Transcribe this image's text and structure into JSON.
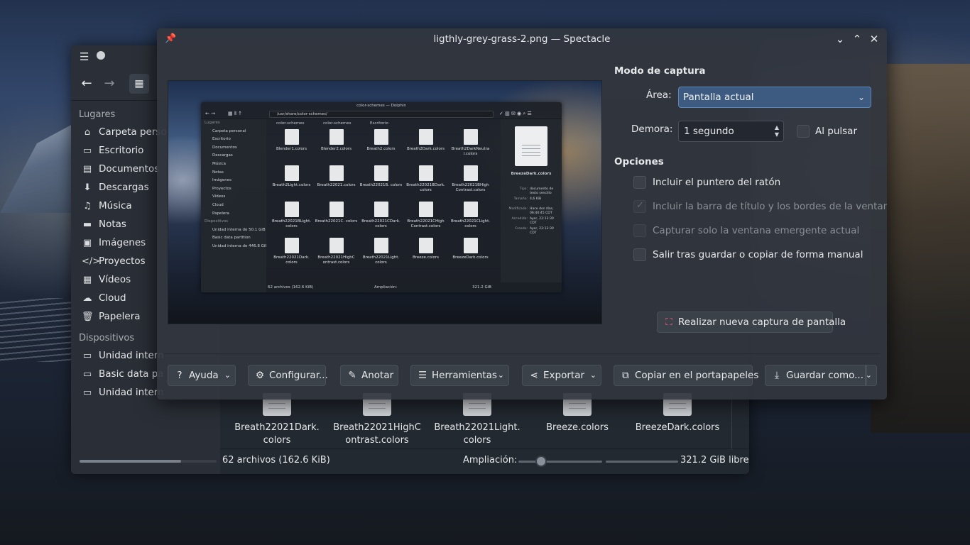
{
  "dolphin": {
    "sidebar": {
      "places_heading": "Lugares",
      "places": [
        {
          "icon": "home-icon",
          "glyph": "⌂",
          "label": "Carpeta perso"
        },
        {
          "icon": "desktop-icon",
          "glyph": "▭",
          "label": "Escritorio"
        },
        {
          "icon": "documents-icon",
          "glyph": "▤",
          "label": "Documentos"
        },
        {
          "icon": "downloads-icon",
          "glyph": "⬇",
          "label": "Descargas"
        },
        {
          "icon": "music-icon",
          "glyph": "♫",
          "label": "Música"
        },
        {
          "icon": "notes-folder-icon",
          "glyph": "▬",
          "label": "Notas"
        },
        {
          "icon": "images-icon",
          "glyph": "▣",
          "label": "Imágenes"
        },
        {
          "icon": "code-icon",
          "glyph": "</>",
          "label": "Proyectos"
        },
        {
          "icon": "videos-icon",
          "glyph": "▦",
          "label": "Vídeos"
        },
        {
          "icon": "cloud-icon",
          "glyph": "☁",
          "label": "Cloud"
        },
        {
          "icon": "trash-icon",
          "glyph": "🗑",
          "label": "Papelera"
        }
      ],
      "devices_heading": "Dispositivos",
      "devices": [
        {
          "icon": "drive-icon",
          "glyph": "▭",
          "label": "Unidad intern"
        },
        {
          "icon": "drive-icon",
          "glyph": "▭",
          "label": "Basic data pa"
        },
        {
          "icon": "drive-icon",
          "glyph": "▭",
          "label": "Unidad intern"
        }
      ]
    },
    "files": [
      {
        "line1": "Breath22021Dark.",
        "line2": "colors"
      },
      {
        "line1": "Breath22021HighC",
        "line2": "ontrast.colors"
      },
      {
        "line1": "Breath22021Light.",
        "line2": "colors"
      },
      {
        "line1": "Breeze.colors",
        "line2": ""
      },
      {
        "line1": "BreezeDark.colors",
        "line2": ""
      }
    ],
    "status": {
      "count": "62 archivos (162.6 KiB)",
      "zoom_label": "Ampliación:",
      "free": "321.2 GiB libre"
    }
  },
  "spectacle": {
    "title": "ligthly-grey-grass-2.png — Spectacle",
    "preview": {
      "title": "color-schemes — Dolphin",
      "path": "/usr/share/color-schemes/",
      "tabs": [
        "color-schemes",
        "color-schemes",
        "Escritorio"
      ],
      "side_places_heading": "Lugares",
      "side_places": [
        "Carpeta personal",
        "Escritorio",
        "Documentos",
        "Descargas",
        "Música",
        "Notas",
        "Imágenes",
        "Proyectos",
        "Vídeos",
        "Cloud",
        "Papelera"
      ],
      "side_devices_heading": "Dispositivos",
      "side_devices": [
        "Unidad interna de 50.1 GiB",
        "Basic data partition",
        "Unidad interna de 446.8 GiB"
      ],
      "files": [
        "Blender1.colors",
        "Blender2.colors",
        "Breath2.colors",
        "Breath2Dark.colors",
        "Breath2DarkNeutra l.colors",
        "Breath2Light.colors",
        "Breath22021.colors",
        "Breath22021B. colors",
        "Breath22021BDark. colors",
        "Breath22021BHigh Contrast.colors",
        "Breath22021BLight. colors",
        "Breath22021C. colors",
        "Breath22021CDark. colors",
        "Breath22021CHigh Contrast.colors",
        "Breath22021CLight. colors",
        "Breath22021Dark. colors",
        "Breath22021HighC ontrast.colors",
        "Breath22021Light. colors",
        "Breeze.colors",
        "BreezeDark.colors"
      ],
      "info_name": "BreezeDark.colors",
      "info": [
        {
          "k": "Tipo:",
          "v": "documento de texto sencillo"
        },
        {
          "k": "Tamaño:",
          "v": "4,6 KiB"
        },
        {
          "k": "Modificado:",
          "v": "Hace dos días, 06:40:45 CDT"
        },
        {
          "k": "Accedido:",
          "v": "Ayer, 22:13:30 CDT"
        },
        {
          "k": "Creado:",
          "v": "Ayer, 22:13:30 CDT"
        }
      ],
      "status_count": "62 archivos (162.6 KiB)",
      "status_zoom": "Ampliación:",
      "status_free": "321.2 GiB libre"
    },
    "capture": {
      "heading": "Modo de captura",
      "area_label": "Área:",
      "area_value": "Pantalla actual",
      "delay_label": "Demora:",
      "delay_value": "1 segundo",
      "on_click_label": "Al pulsar"
    },
    "options": {
      "heading": "Opciones",
      "items": [
        {
          "label": "Incluir el puntero del ratón",
          "checked": false,
          "enabled": true
        },
        {
          "label": "Incluir la barra de título y los bordes de la ventana",
          "checked": true,
          "enabled": false
        },
        {
          "label": "Capturar solo la ventana emergente actual",
          "checked": false,
          "enabled": false
        },
        {
          "label": "Salir tras guardar o copiar de forma manual",
          "checked": false,
          "enabled": true
        }
      ]
    },
    "new_capture_label": "Realizar nueva captura de pantalla",
    "bottom_buttons": {
      "help": "Ayuda",
      "configure": "Configurar...",
      "annotate": "Anotar",
      "tools": "Herramientas",
      "export": "Exportar",
      "copy": "Copiar en el portapapeles",
      "save": "Guardar como..."
    }
  },
  "colors": {
    "accent": "#3d5a80",
    "accent_border": "#5f86b8",
    "window_bg": "#31363e",
    "new_capture_icon": "#ff4f7c"
  }
}
